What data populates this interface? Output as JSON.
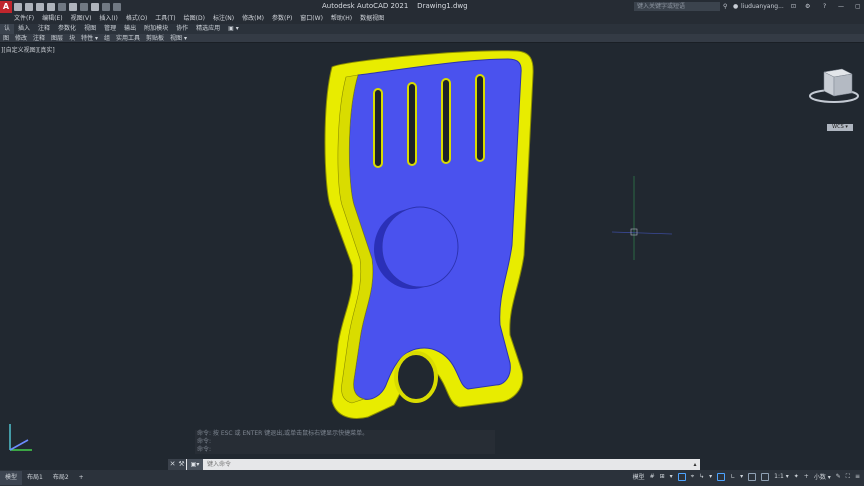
{
  "app": {
    "title": "Autodesk AutoCAD 2021    Drawing1.dwg",
    "logo": "A",
    "search_placeholder": "键入关键字或短语",
    "user": "liuduanyang...",
    "icons": [
      "search-icon",
      "user-icon",
      "cart-icon",
      "share-icon",
      "help-icon"
    ]
  },
  "menu": {
    "items": [
      "文件(F)",
      "编辑(E)",
      "视图(V)",
      "插入(I)",
      "格式(O)",
      "工具(T)",
      "绘图(D)",
      "标注(N)",
      "修改(M)",
      "参数(P)",
      "窗口(W)",
      "帮助(H)",
      "数据视图"
    ]
  },
  "ribbon": {
    "tabs": [
      "认",
      "插入",
      "注释",
      "参数化",
      "视图",
      "管理",
      "输出",
      "附加模块",
      "协作",
      "精选应用",
      "▣ ▾"
    ],
    "panels": [
      "图",
      "修改",
      "注释",
      "图层",
      "块",
      "特性 ▾",
      "组",
      "实用工具",
      "剪贴板",
      "视图 ▾"
    ]
  },
  "viewport": {
    "label": "][自定义视图][真实]",
    "wcs": "WCS ▾"
  },
  "colors": {
    "part_yellow": "#eef000",
    "part_blue": "#4a52ee",
    "background": "#212830"
  },
  "command": {
    "history": [
      "命令:  按 ESC 或 ENTER 键退出,或单击鼠标右键显示快捷菜单。",
      "命令:",
      "命令:"
    ],
    "placeholder": "键入命令",
    "close": "✕",
    "wrench": "🔧",
    "mode_icon": "▣▾"
  },
  "statusbar": {
    "layout_tabs": [
      "模型",
      "布局1",
      "布局2",
      "+"
    ],
    "model_label": "模型",
    "scale": "1:1 ▾",
    "units": "小数 ▾",
    "items": [
      "#",
      "⊞",
      "▾",
      "⌖",
      "↳",
      "▾",
      "∟",
      "▾",
      "1:1",
      "▾",
      "✦",
      "▾"
    ]
  }
}
